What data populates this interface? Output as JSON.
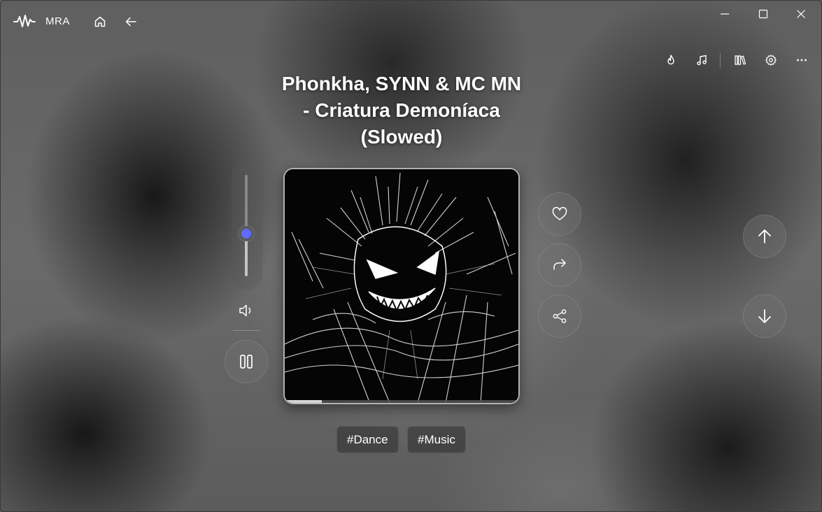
{
  "app": {
    "name": "MRA"
  },
  "titlebar": {
    "logo_icon": "audio-wave-icon",
    "home_icon": "home-icon",
    "back_icon": "arrow-left-icon",
    "minimize_icon": "minimize-icon",
    "maximize_icon": "maximize-icon",
    "close_icon": "close-icon"
  },
  "toolbar": {
    "items": [
      {
        "name": "trending",
        "icon": "flame-icon"
      },
      {
        "name": "music",
        "icon": "music-note-icon"
      },
      {
        "name": "library",
        "icon": "library-icon"
      },
      {
        "name": "settings",
        "icon": "gear-icon"
      },
      {
        "name": "more",
        "icon": "more-icon"
      }
    ]
  },
  "song": {
    "title_line1": "Phonkha, SYNN & MC MN",
    "title_line2": "- Criatura Demoníaca",
    "title_line3": "(Slowed)",
    "cover_description": "monochrome spiky demon artwork",
    "progress": 0.16
  },
  "volume": {
    "level": 0.42,
    "accent": "#5f6bff",
    "speaker_icon": "speaker-icon"
  },
  "controls": {
    "play_pause_icon": "pause-icon",
    "like_icon": "heart-icon",
    "forward_icon": "redo-arrow-icon",
    "share_icon": "share-icon",
    "previous_icon": "arrow-up-icon",
    "next_icon": "arrow-down-icon"
  },
  "tags": [
    "#Dance",
    "#Music"
  ]
}
